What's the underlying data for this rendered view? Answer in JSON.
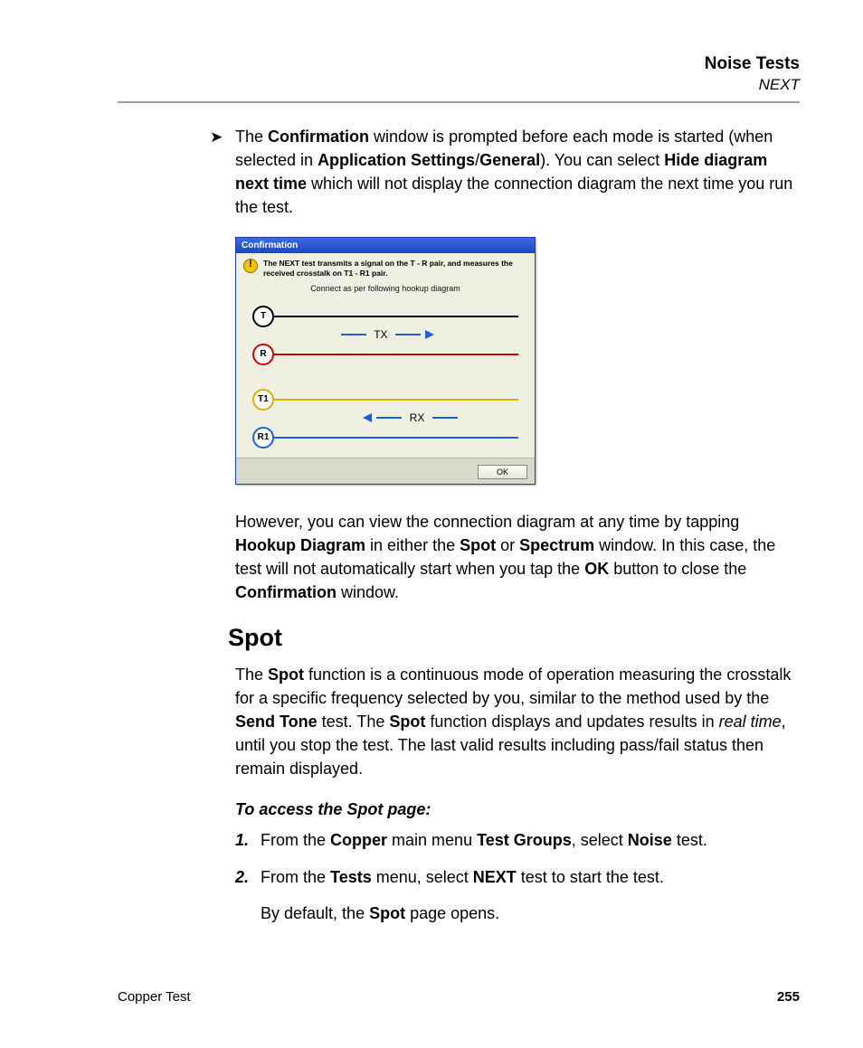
{
  "header": {
    "title": "Noise Tests",
    "subtitle": "NEXT"
  },
  "bullet1": {
    "pre": "The ",
    "b1": "Confirmation",
    "t1": " window is prompted before each mode is started (when selected in ",
    "b2": "Application Settings",
    "slash": "/",
    "b3": "General",
    "t2": "). You can select ",
    "b4": "Hide diagram next time",
    "t3": " which will not display the connection diagram the next time you run the test."
  },
  "dialog": {
    "title": "Confirmation",
    "msg": "The NEXT test transmits a signal on the T - R pair, and measures the received crosstalk on T1 - R1 pair.",
    "subtitle": "Connect as per following hookup diagram",
    "nodes": {
      "t": "T",
      "r": "R",
      "t1": "T1",
      "r1": "R1"
    },
    "labels": {
      "tx": "TX",
      "rx": "RX"
    },
    "ok": "OK"
  },
  "para_after": {
    "t1": "However, you can view the connection diagram at any time by tapping ",
    "b1": "Hookup Diagram",
    "t2": " in either the ",
    "b2": "Spot",
    "t3": " or ",
    "b3": "Spectrum",
    "t4": " window. In this case, the test will not automatically start when you tap the ",
    "b4": "OK",
    "t5": " button to close the ",
    "b5": "Confirmation",
    "t6": " window."
  },
  "spot": {
    "heading": "Spot",
    "para": {
      "t1": "The ",
      "b1": "Spot",
      "t2": " function is a continuous mode of operation measuring the crosstalk for a specific frequency selected by you, similar to the method used by the ",
      "b2": "Send Tone",
      "t3": " test. The ",
      "b3": "Spot",
      "t4": " function displays and updates results in ",
      "i1": "real time",
      "t5": ", until you stop the test. The last valid results including pass/fail status then remain displayed."
    },
    "subhead": "To access the Spot page:",
    "step1": {
      "num": "1.",
      "t1": "From the ",
      "b1": "Copper",
      "t2": " main menu ",
      "b2": "Test Groups",
      "t3": ", select ",
      "b3": "Noise",
      "t4": " test."
    },
    "step2": {
      "num": "2.",
      "t1": "From the ",
      "b1": "Tests",
      "t2": " menu, select ",
      "b2": "NEXT",
      "t3": " test to start the test."
    },
    "step2b": {
      "t1": "By default, the ",
      "b1": "Spot",
      "t2": " page opens."
    }
  },
  "footer": {
    "left": "Copper Test",
    "page": "255"
  }
}
